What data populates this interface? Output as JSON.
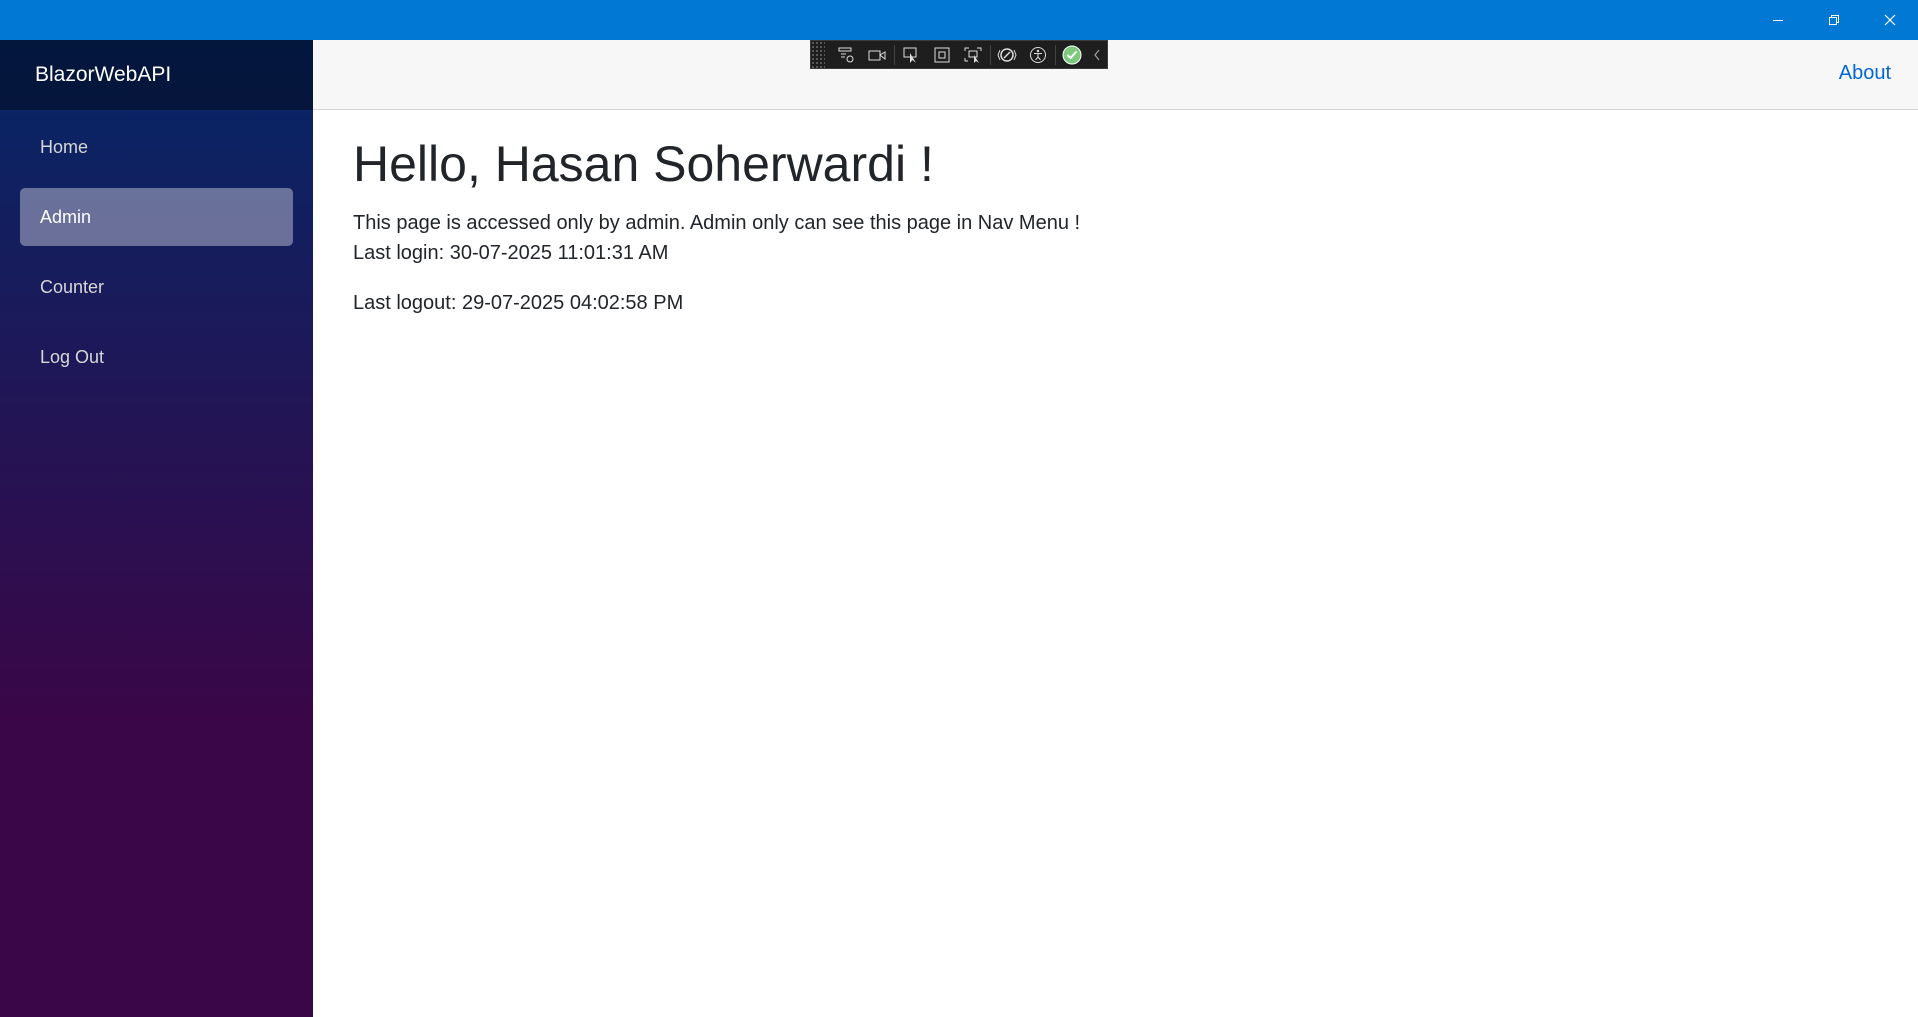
{
  "window": {
    "controls": [
      "minimize-icon",
      "restore-icon",
      "close-icon"
    ],
    "accent_color": "#0078d4"
  },
  "sidebar": {
    "brand": "BlazorWebAPI",
    "items": [
      {
        "label": "Home",
        "active": false
      },
      {
        "label": "Admin",
        "active": true
      },
      {
        "label": "Counter",
        "active": false
      },
      {
        "label": "Log Out",
        "active": false
      }
    ]
  },
  "top_row": {
    "about_label": "About"
  },
  "dev_toolbar": {
    "tools": [
      "live-visual-tree-icon",
      "record-icon",
      "select-element-icon",
      "display-layout-adorners-icon",
      "track-focus-icon",
      "hot-reload-icon",
      "accessibility-icon",
      "binding-check-icon",
      "collapse-chevron-icon"
    ]
  },
  "main": {
    "greeting": "Hello, Hasan Soherwardi !",
    "description": "This page is accessed only by admin. Admin only can see this page in Nav Menu !",
    "last_login": "Last login: 30-07-2025 11:01:31 AM",
    "last_logout": "Last logout: 29-07-2025 04:02:58 PM"
  }
}
